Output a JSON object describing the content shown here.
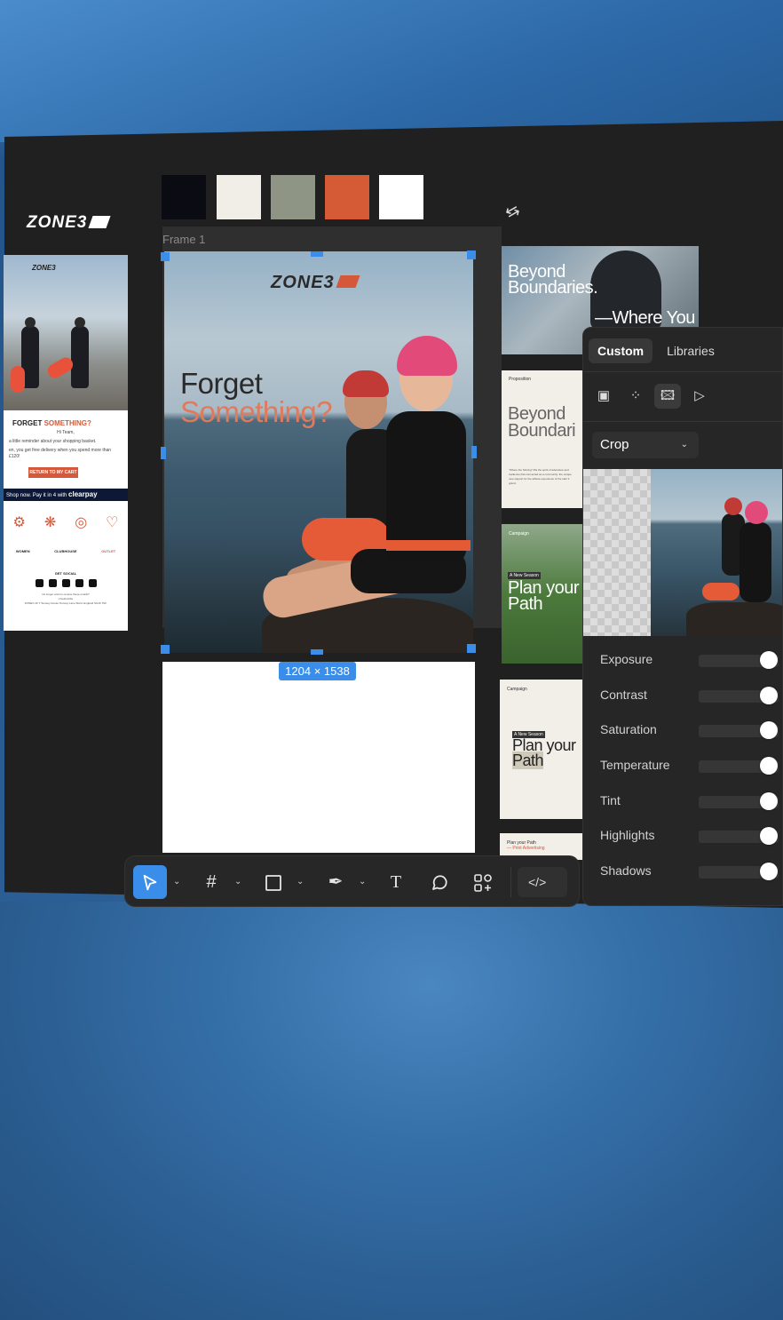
{
  "brand": {
    "logo_text": "ZONE3"
  },
  "palette": [
    "#0b0b14",
    "#f1eee8",
    "#8f9585",
    "#d55a36",
    "#ffffff"
  ],
  "email": {
    "logo_text": "ZONE3",
    "title_a": "FORGET ",
    "title_b": "SOMETHING?",
    "greeting": "Hi Team,",
    "line1": "a little reminder about your shopping basket.",
    "line2": "en, you get free delivery when you spend more than £120!",
    "button": "RETURN TO MY CART",
    "clearpay_prefix": "Shop now. Pay it in 4 with",
    "clearpay_brand": "clearpay",
    "nav": [
      "WOMEN",
      "CLUBHOUSE",
      "OUTLET"
    ],
    "social_title": "GET SOCIAL",
    "footer1": "No longer want to receive these emails?",
    "footer2": "Unsubscribe",
    "footer3": "ZONE3 UK T Temsey House Temsey Lane Ward, England SG16 7NF"
  },
  "frame": {
    "label": "Frame 1",
    "logo_text": "ZONE3",
    "headline_1": "Forget",
    "headline_2": "Something?",
    "dimensions": "1204 × 1538"
  },
  "thumbnails": {
    "t1": {
      "line1": "Beyond",
      "line2": "Boundaries.",
      "line3": "—Where You"
    },
    "t2": {
      "small": "Proposition",
      "line1": "Beyond",
      "line2": "Boundari",
      "para": "\"Where the Striving\" lifts the spirit of adventure and resilience that connected as a community: the unique new support for the athlete experience of the start it grand."
    },
    "t3": {
      "small": "Campaign",
      "tag": "A New Season",
      "line1": "Plan your",
      "line2": "Path"
    },
    "t4": {
      "small": "Campaign",
      "tag": "A New Season",
      "line1": "Plan your",
      "line2": "Path"
    },
    "t5": {
      "line1": "Plan your Path",
      "line2": "— Print Advertising"
    }
  },
  "panel": {
    "tabs": [
      "Custom",
      "Libraries"
    ],
    "modes": [
      "fill-mode-icon",
      "noise-icon",
      "image-icon",
      "video-icon"
    ],
    "crop_label": "Crop",
    "adjustments": [
      {
        "label": "Exposure",
        "value": 1.0
      },
      {
        "label": "Contrast",
        "value": 1.0
      },
      {
        "label": "Saturation",
        "value": 1.0
      },
      {
        "label": "Temperature",
        "value": 1.0
      },
      {
        "label": "Tint",
        "value": 1.0
      },
      {
        "label": "Highlights",
        "value": 1.0
      },
      {
        "label": "Shadows",
        "value": 1.0
      }
    ]
  },
  "toolbar": {
    "tools": [
      "select-tool-icon",
      "frame-tool-icon",
      "rectangle-tool-icon",
      "pen-tool-icon",
      "text-tool-icon",
      "comment-tool-icon",
      "components-tool-icon"
    ],
    "code_label": "</>"
  },
  "colors": {
    "accent": "#3a8de8",
    "brand_orange": "#d5583a",
    "canvas": "#202020"
  }
}
